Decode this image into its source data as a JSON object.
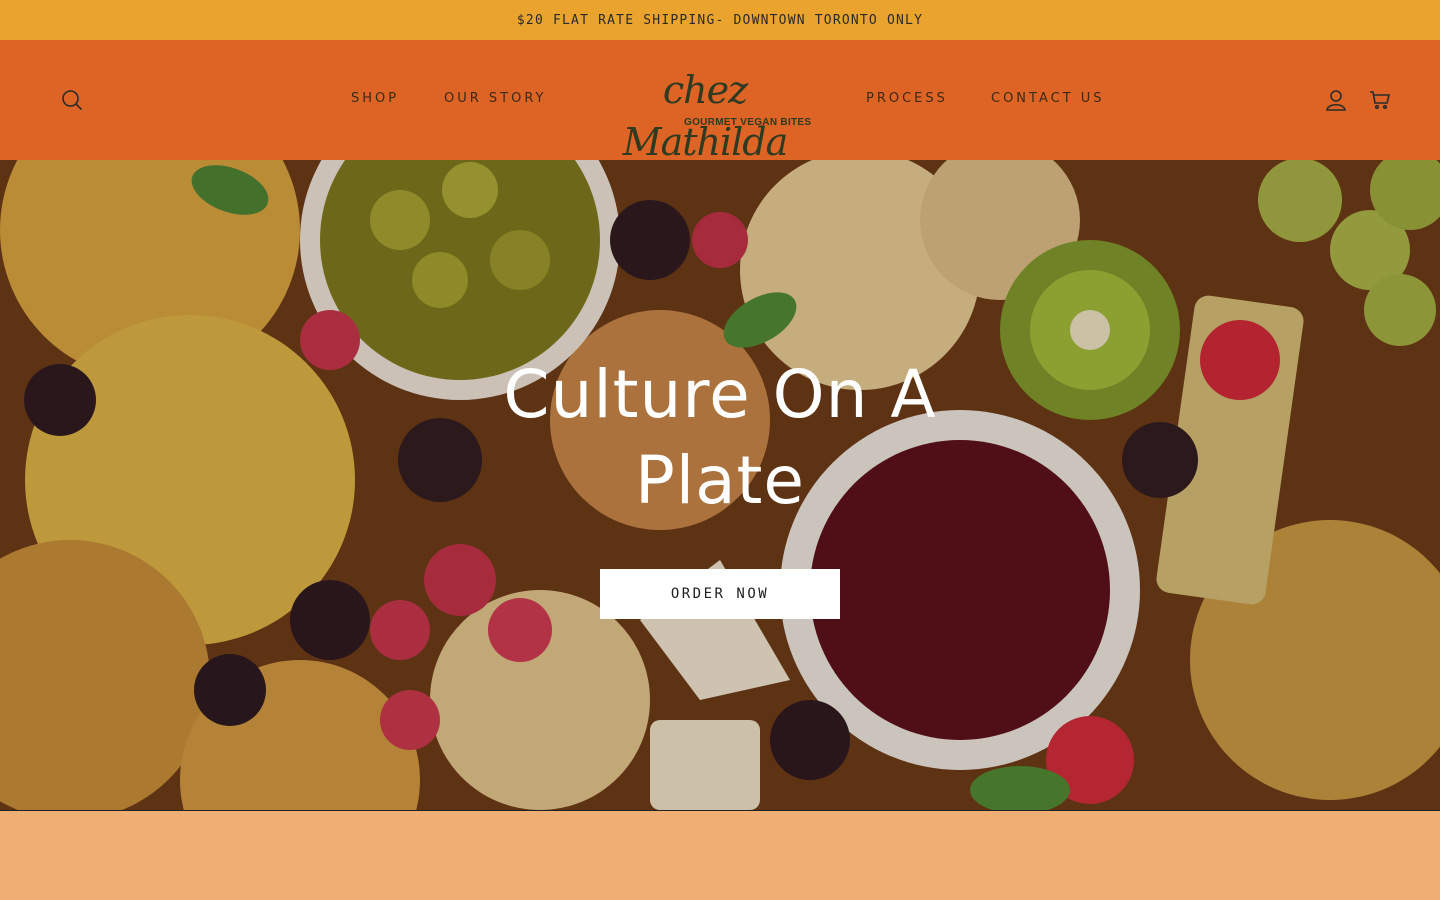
{
  "announcement": {
    "text": "$20 FLAT RATE SHIPPING- DOWNTOWN TORONTO ONLY"
  },
  "header": {
    "nav_left": [
      {
        "label": "SHOP"
      },
      {
        "label": "OUR STORY"
      }
    ],
    "nav_right": [
      {
        "label": "PROCESS"
      },
      {
        "label": "CONTACT US"
      }
    ],
    "logo": {
      "script": "chez Mathilda",
      "tagline": "GOURMET VEGAN BITES"
    },
    "icons": [
      "search-icon",
      "account-icon",
      "cart-icon"
    ]
  },
  "hero": {
    "title": "Culture On A Plate",
    "cta": "ORDER NOW"
  },
  "colors": {
    "announcement_bg": "#eaa42e",
    "header_bg": "#dd6425",
    "footer_band": "#efaf74",
    "button_bg": "#ffffff"
  }
}
